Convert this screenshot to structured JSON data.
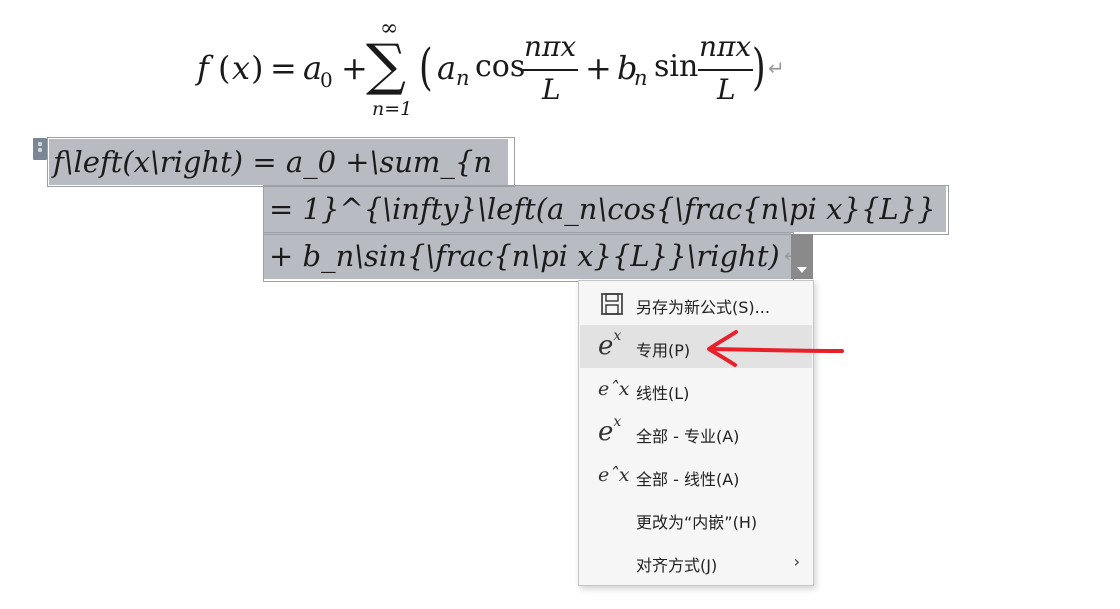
{
  "formula": {
    "f": "f",
    "lp": "(",
    "x": "x",
    "rp": ")",
    "eq": "=",
    "a0_base": "a",
    "a0_sub": "0",
    "plus": "+",
    "sum_symbol": "∑",
    "sum_upper": "∞",
    "sum_lower": "n=1",
    "big_lp": "(",
    "an_base": "a",
    "an_sub": "n",
    "cos": "cos",
    "frac1_num": "nπx",
    "frac1_den": "L",
    "plus2": "+",
    "bn_base": "b",
    "bn_sub": "n",
    "sin": "sin",
    "frac2_num": "nπx",
    "frac2_den": "L",
    "big_rp": ")",
    "para_mark": "↵"
  },
  "source": {
    "line1": "f\\left(x\\right) = a_0 +\\sum_{n",
    "line2": "= 1}^{\\infty}\\left(a_n\\cos{\\frac{n\\pi x}{L}}",
    "line3": "+ b_n\\sin{\\frac{n\\pi x}{L}}\\right)",
    "para_mark": "↵"
  },
  "menu": {
    "items": [
      {
        "icon": "save-icon",
        "label": "另存为新公式(S)..."
      },
      {
        "icon": "professional-icon",
        "icon_base": "e",
        "icon_sup": "x",
        "label": "专用(P)"
      },
      {
        "icon": "linear-icon",
        "icon_text": "eˆx",
        "label": "线性(L)"
      },
      {
        "icon": "professional-icon",
        "icon_base": "e",
        "icon_sup": "x",
        "label": "全部 - 专业(A)"
      },
      {
        "icon": "linear-icon",
        "icon_text": "eˆx",
        "label": "全部 - 线性(A)"
      },
      {
        "icon": "",
        "label": "更改为“内嵌”(H)"
      },
      {
        "icon": "chevron-right-icon",
        "label": "对齐方式(J)",
        "chevron": "›"
      }
    ]
  },
  "colors": {
    "selection": "#b8bcc2",
    "annotation_arrow": "#e8202a",
    "menu_highlight": "#e2e2e2"
  }
}
